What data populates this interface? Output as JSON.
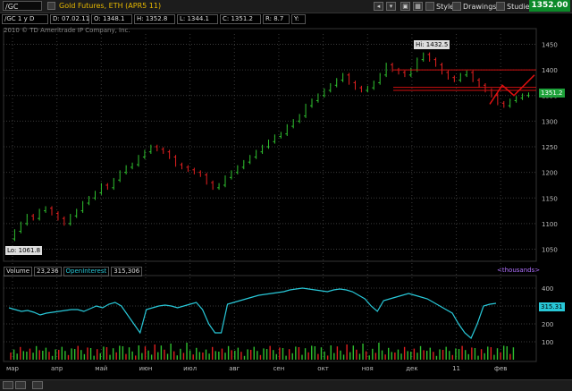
{
  "toolbar": {
    "symbol": "/GC",
    "description": "Gold Futures, ETH (APR5 11)",
    "style_label": "Style",
    "drawings_label": "Drawings",
    "studies_label": "Studies",
    "last_price": "1352.00"
  },
  "infobar": {
    "timeframe": "/GC 1 y D",
    "date": "D: 07.02.11",
    "open": "O: 1348.1",
    "high": "H: 1352.8",
    "low": "L: 1344.1",
    "close": "C: 1351.2",
    "range": "R: 8.7",
    "yield": "Y:"
  },
  "copyright": "2010 © TD Ameritrade IP Company, Inc.",
  "annotations": {
    "high_label": "Hi: 1432.5",
    "low_label": "Lo: 1061.8",
    "price_badge": "1351.2",
    "oi_badge": "315.31"
  },
  "volume_panel": {
    "volume_label": "Volume",
    "volume_value": "23,236",
    "oi_label": "OpenInterest",
    "oi_value": "315,306",
    "units_label": "<thousands>"
  },
  "colors": {
    "up": "#2fbf2f",
    "down": "#e02020",
    "openinterest": "#28c8d8",
    "resistance": "#d01010",
    "arrow": "#e01010",
    "grid": "#3a3a3a"
  },
  "chart_data": {
    "type": "line",
    "price_axis": {
      "ylim": [
        1030,
        1470
      ],
      "ticks": [
        1050,
        1100,
        1150,
        1200,
        1250,
        1300,
        1350,
        1400,
        1450
      ]
    },
    "volume_axis": {
      "ylim": [
        0,
        450
      ],
      "ticks": [
        100,
        200,
        300,
        400
      ]
    },
    "x_ticks": [
      "мар",
      "апр",
      "май",
      "июн",
      "июл",
      "авг",
      "сен",
      "окт",
      "ноя",
      "дек",
      "11",
      "фев"
    ],
    "series": [
      {
        "values": [
          1070,
          1085,
          1100,
          1115,
          1110,
          1125,
          1130,
          1120,
          1110,
          1100,
          1115,
          1125,
          1140,
          1150,
          1160,
          1175,
          1170,
          1185,
          1200,
          1210,
          1215,
          1230,
          1240,
          1250,
          1245,
          1240,
          1230,
          1215,
          1210,
          1205,
          1200,
          1195,
          1180,
          1170,
          1175,
          1190,
          1200,
          1210,
          1220,
          1230,
          1240,
          1250,
          1260,
          1270,
          1275,
          1290,
          1300,
          1310,
          1330,
          1340,
          1350,
          1360,
          1370,
          1380,
          1390,
          1375,
          1365,
          1360,
          1365,
          1375,
          1390,
          1410,
          1400,
          1395,
          1390,
          1400,
          1420,
          1430,
          1420,
          1410,
          1395,
          1385,
          1380,
          1390,
          1395,
          1380,
          1370,
          1360,
          1350,
          1335,
          1330,
          1340,
          1345,
          1350,
          1352
        ]
      },
      {
        "values": [
          290,
          280,
          270,
          275,
          265,
          250,
          260,
          265,
          270,
          275,
          280,
          280,
          270,
          285,
          300,
          290,
          310,
          320,
          300,
          250,
          200,
          150,
          280,
          290,
          300,
          305,
          300,
          290,
          300,
          310,
          320,
          280,
          200,
          150,
          150,
          310,
          320,
          330,
          340,
          350,
          360,
          365,
          370,
          375,
          380,
          390,
          395,
          400,
          395,
          390,
          385,
          380,
          390,
          395,
          390,
          380,
          360,
          340,
          300,
          270,
          330,
          340,
          350,
          360,
          370,
          360,
          350,
          340,
          320,
          300,
          280,
          260,
          200,
          150,
          120,
          200,
          300,
          310,
          315
        ]
      }
    ],
    "levels": [
      1400,
      1366,
      1360
    ]
  },
  "bottombar": {}
}
